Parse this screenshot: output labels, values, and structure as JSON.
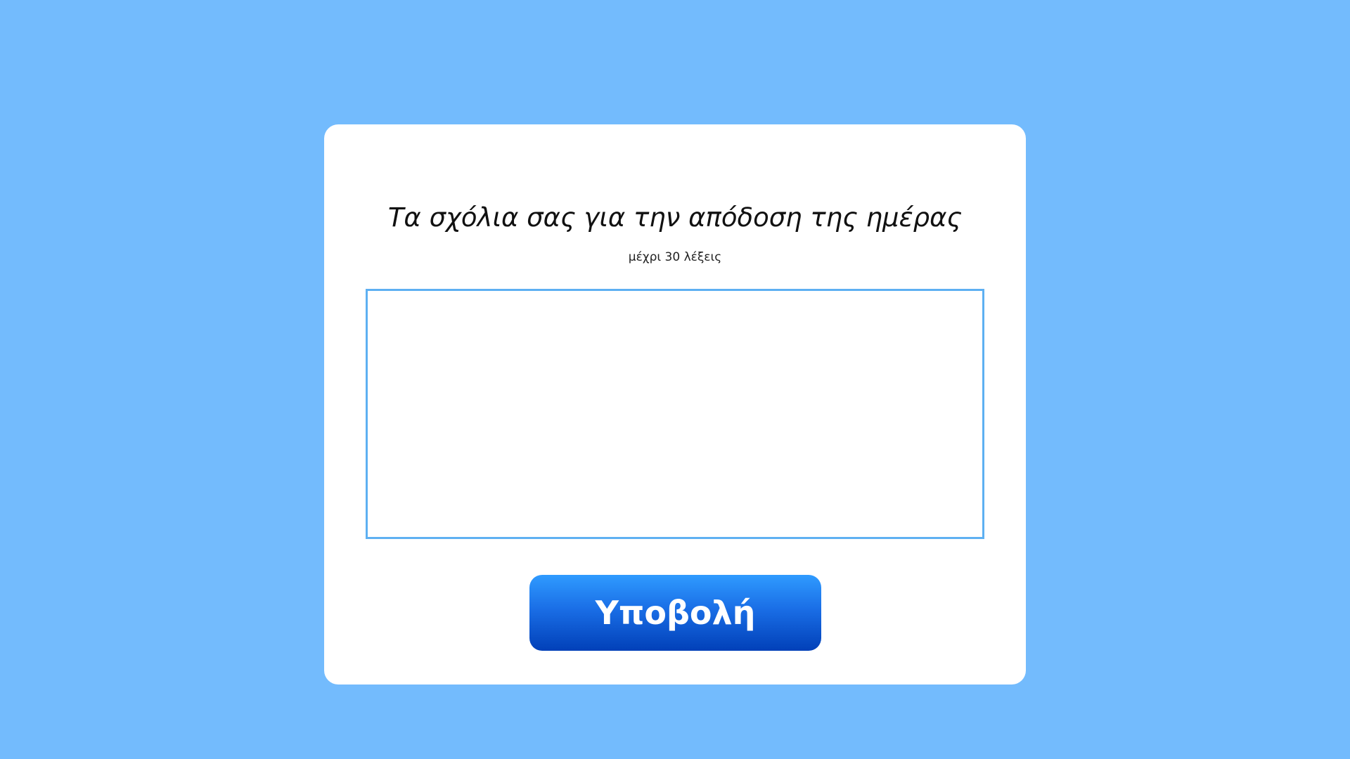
{
  "colors": {
    "background": "#73bbfd",
    "card": "#ffffff",
    "input_border": "#5eb0f2",
    "button_top": "#2f9bff",
    "button_bottom": "#0140b8",
    "button_text": "#ffffff"
  },
  "form": {
    "title": "Τα σχόλια σας για την απόδοση της ημέρας",
    "subtitle": "μέχρι 30 λέξεις",
    "comment_value": "",
    "comment_placeholder": "",
    "submit_label": "Υποβολή"
  }
}
